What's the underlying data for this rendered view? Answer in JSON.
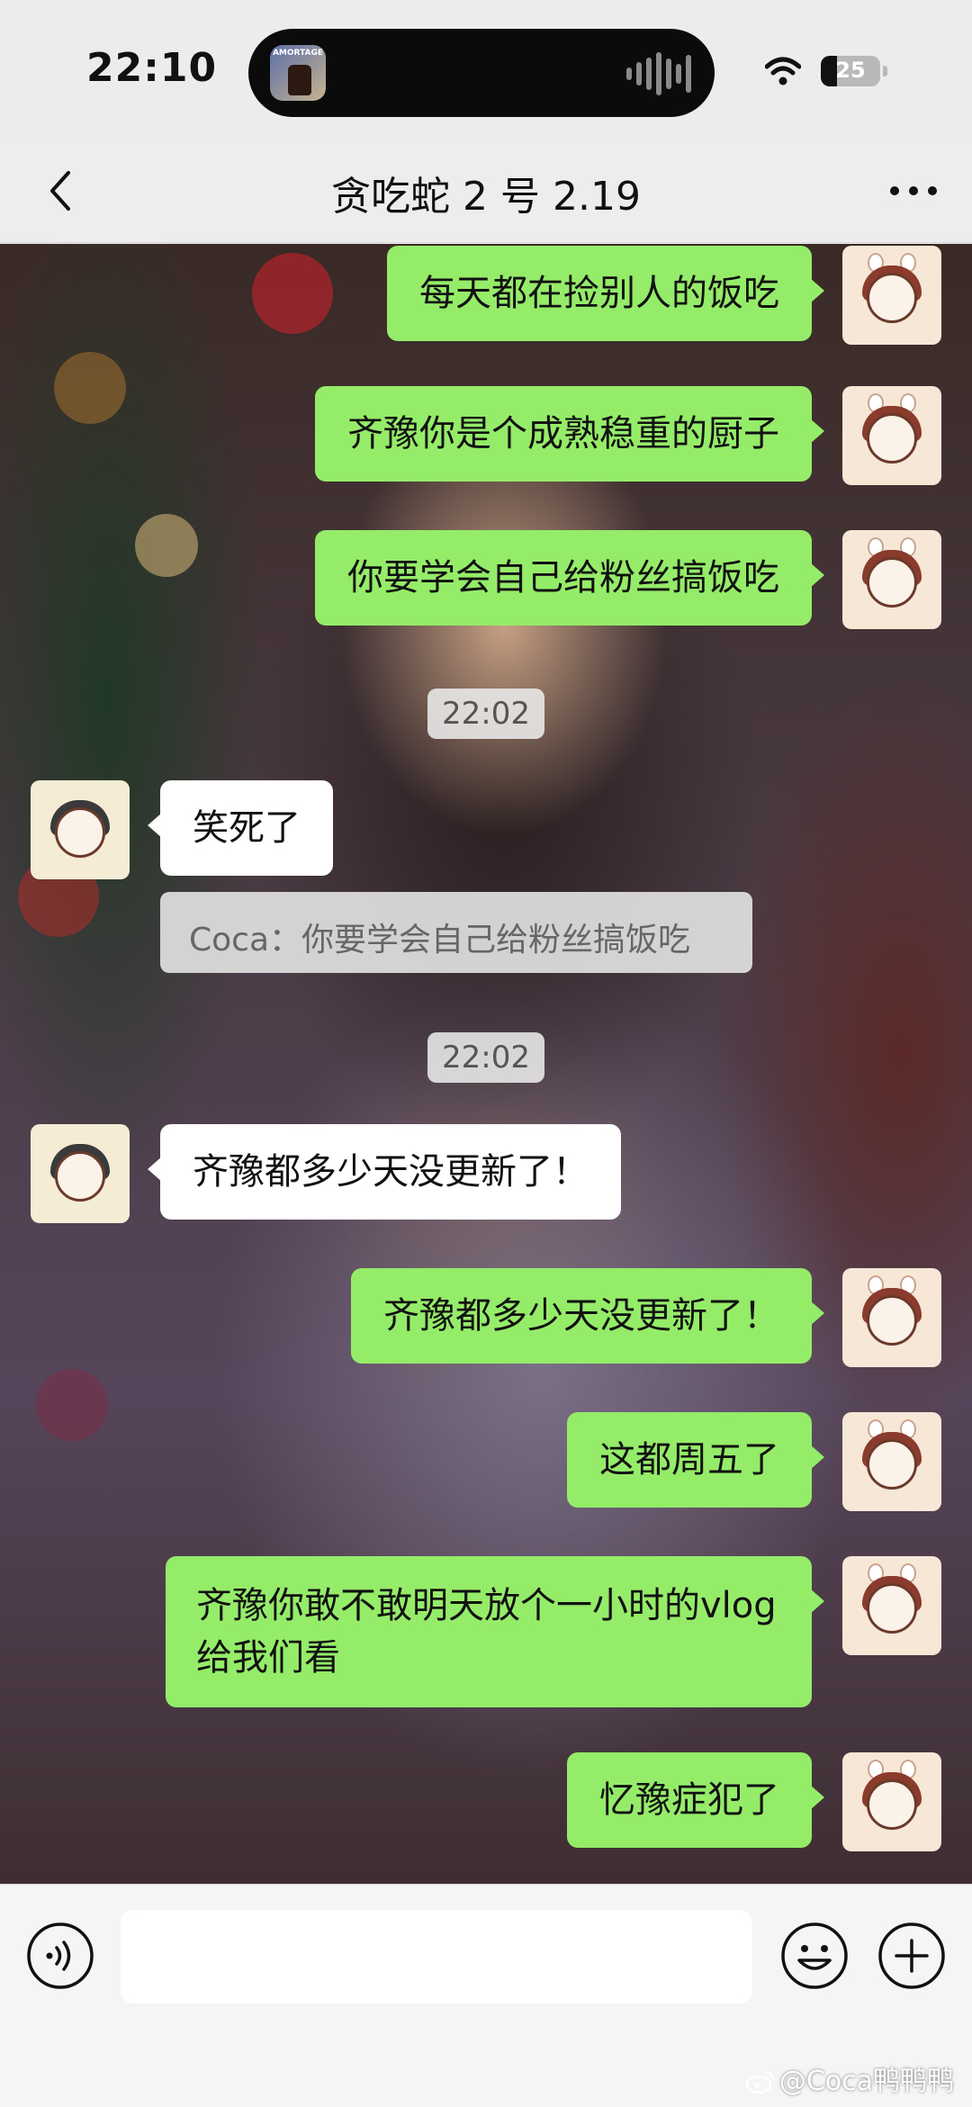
{
  "status_bar": {
    "time": "22:10",
    "island_app_label": "AMORTAGE",
    "battery": "25"
  },
  "nav": {
    "title": "贪吃蛇 2 号 2.19"
  },
  "messages": [
    {
      "side": "right",
      "text": "每天都在捡别人的饭吃"
    },
    {
      "side": "right",
      "text": "齐豫你是个成熟稳重的厨子"
    },
    {
      "side": "right",
      "text": "你要学会自己给粉丝搞饭吃"
    },
    {
      "type": "timestamp",
      "text": "22:02"
    },
    {
      "side": "left",
      "text": "笑死了"
    },
    {
      "type": "quote",
      "text": "Coca：你要学会自己给粉丝搞饭吃"
    },
    {
      "type": "timestamp",
      "text": "22:02"
    },
    {
      "side": "left",
      "text": "齐豫都多少天没更新了！"
    },
    {
      "side": "right",
      "text": "齐豫都多少天没更新了！"
    },
    {
      "side": "right",
      "text": "这都周五了"
    },
    {
      "side": "right",
      "text": "齐豫你敢不敢明天放个一小时的vlog给我们看"
    },
    {
      "side": "right",
      "text": "忆豫症犯了"
    }
  ],
  "input": {
    "value": "",
    "placeholder": ""
  },
  "watermark": "@Coca鸭鸭鸭",
  "icons": {
    "back": "chevron-left-icon",
    "more": "ellipsis-icon",
    "voice": "voice-icon",
    "emoji": "smiley-icon",
    "plus": "plus-icon",
    "wifi": "wifi-icon",
    "battery": "battery-icon"
  },
  "colors": {
    "outgoing_bubble": "#95ec69",
    "incoming_bubble": "#ffffff",
    "nav_background": "#ededed"
  }
}
